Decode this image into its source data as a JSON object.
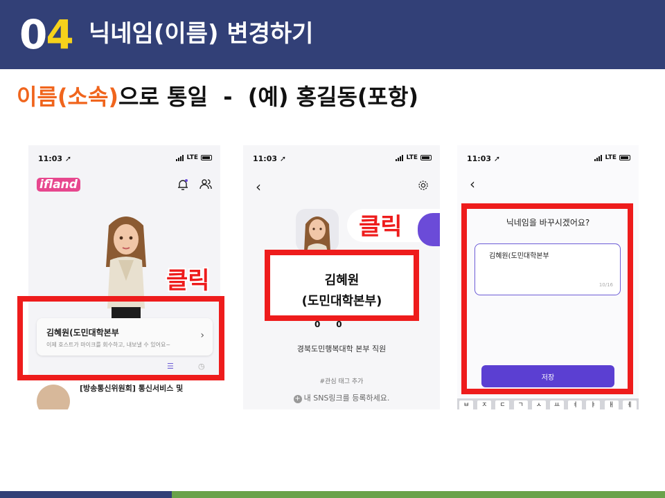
{
  "header": {
    "number_first": "0",
    "number_second": "4",
    "title": "닉네임(이름) 변경하기",
    "bg_color": "#324077",
    "accent_color": "#f6d21b"
  },
  "subtitle": {
    "highlight": "이름(소속)",
    "rest": "으로 통일  -  (예) 홍길동(포항)",
    "highlight_color": "#f0651d"
  },
  "status_bar": {
    "time": "11:03",
    "network": "LTE"
  },
  "screen1": {
    "logo": "ifland",
    "card_name": "김혜원(도민대학본부",
    "card_desc": "이제 호스트가 마이크를 회수하고, 내보낼 수 있어요~",
    "news_title": "[방송통신위원회] 통신서비스 및"
  },
  "screen2": {
    "stat_value_1": "0",
    "stat_value_2": "0",
    "bio": "경북도민행복대학 본부 직원",
    "tag_add": "#관심 태그 추가",
    "sns_link": "내 SNS링크를 등록하세요."
  },
  "screen3": {
    "question": "닉네임을 바꾸시겠어요?",
    "input_value": "김혜원(도민대학본부",
    "char_count": "10/16",
    "save_label": "저장",
    "accent_color": "#5b3fd2"
  },
  "highlights": {
    "click_label": "클릭",
    "name": "김혜원",
    "org": "(도민대학본부)",
    "red_color": "#ee1c1c"
  },
  "footer": {
    "left_color": "#324077",
    "right_color": "#6aa24a"
  }
}
